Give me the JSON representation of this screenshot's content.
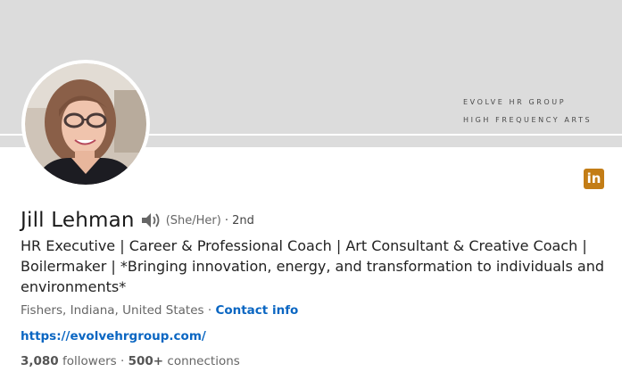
{
  "banner": {
    "line1": "EVOLVE HR GROUP",
    "line2": "HIGH FREQUENCY ARTS",
    "background_color": "#dcdcdc"
  },
  "profile": {
    "name": "Jill Lehman",
    "pronouns": "(She/Her)",
    "degree": "· 2nd",
    "headline": "HR Executive | Career & Professional Coach | Art Consultant & Creative Coach | Boilermaker | *Bringing innovation, energy, and transformation to individuals and environments*",
    "location": "Fishers, Indiana, United States",
    "location_separator": " · ",
    "contact_label": "Contact info",
    "website": "https://evolvehrgroup.com/",
    "followers_count": "3,080",
    "followers_label": "followers",
    "stats_separator": " · ",
    "connections_count": "500+",
    "connections_label": "connections"
  },
  "icons": {
    "speaker": "speaker-icon",
    "linkedin": "linkedin-logo"
  },
  "logo_text": "in",
  "colors": {
    "link": "#0a66c2",
    "linkedin_logo": "#c37d16"
  }
}
